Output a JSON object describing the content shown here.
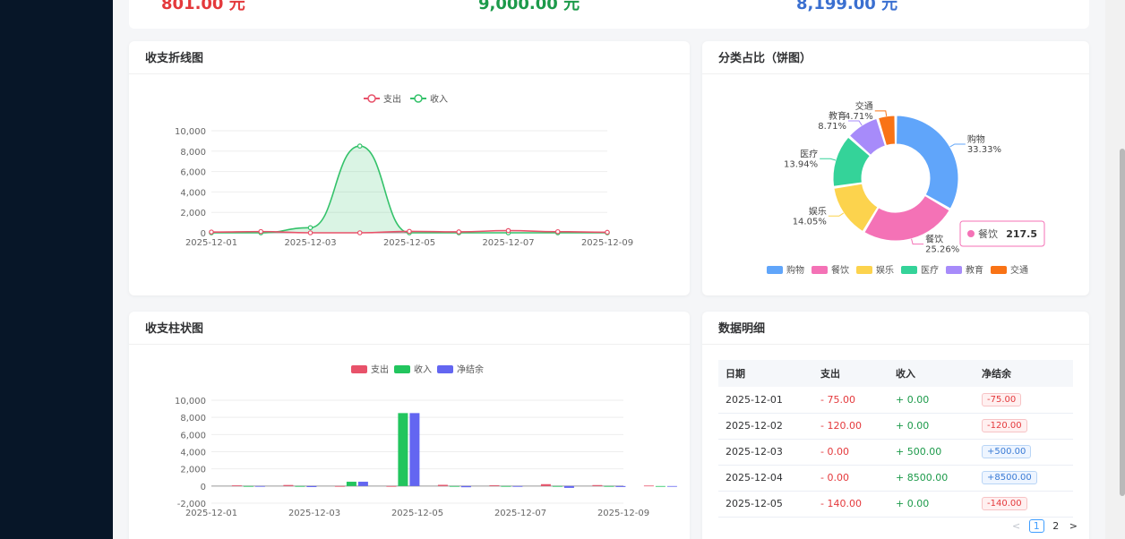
{
  "stats": {
    "expense": "801.00 元",
    "income": "9,000.00 元",
    "balance": "8,199.00 元"
  },
  "colors": {
    "expense": "#e4393c",
    "income": "#1c9a4a",
    "balance": "#3a6fd0",
    "net": "#6366f1"
  },
  "line_card": {
    "title": "收支折线图"
  },
  "pie_card": {
    "title": "分类占比（饼图）"
  },
  "bar_card": {
    "title": "收支柱状图"
  },
  "table_card": {
    "title": "数据明细"
  },
  "pie_tooltip": {
    "label": "餐饮",
    "value": "217.5"
  },
  "chart_data": [
    {
      "type": "line",
      "legend": [
        "支出",
        "收入"
      ],
      "x": [
        "2025-12-01",
        "2025-12-02",
        "2025-12-03",
        "2025-12-04",
        "2025-12-05",
        "2025-12-06",
        "2025-12-07",
        "2025-12-08",
        "2025-12-09"
      ],
      "x_tick_labels": [
        "2025-12-01",
        "2025-12-03",
        "2025-12-05",
        "2025-12-07",
        "2025-12-09"
      ],
      "series": [
        {
          "name": "支出",
          "color": "#e8526a",
          "values": [
            75,
            120,
            0,
            0,
            140,
            90,
            216,
            110,
            50
          ]
        },
        {
          "name": "收入",
          "color": "#34c26a",
          "values": [
            0,
            0,
            500,
            8500,
            0,
            0,
            0,
            0,
            0
          ],
          "area": true
        }
      ],
      "y_ticks": [
        "0",
        "2,000",
        "4,000",
        "6,000",
        "8,000",
        "10,000"
      ],
      "ylim": [
        0,
        10000
      ]
    },
    {
      "type": "pie",
      "slices": [
        {
          "label": "购物",
          "percent": "33.33%",
          "value": 33.33,
          "color": "#60a5fa"
        },
        {
          "label": "餐饮",
          "percent": "25.26%",
          "value": 25.26,
          "color": "#f472b6"
        },
        {
          "label": "娱乐",
          "percent": "14.05%",
          "value": 14.05,
          "color": "#fcd34d"
        },
        {
          "label": "医疗",
          "percent": "13.94%",
          "value": 13.94,
          "color": "#34d399"
        },
        {
          "label": "教育",
          "percent": "8.71%",
          "value": 8.71,
          "color": "#a78bfa"
        },
        {
          "label": "交通",
          "percent": "4.71%",
          "value": 4.71,
          "color": "#f97316"
        }
      ]
    },
    {
      "type": "bar",
      "legend": [
        "支出",
        "收入",
        "净结余"
      ],
      "x": [
        "2025-12-01",
        "2025-12-02",
        "2025-12-03",
        "2025-12-04",
        "2025-12-05",
        "2025-12-06",
        "2025-12-07",
        "2025-12-08",
        "2025-12-09"
      ],
      "x_tick_labels": [
        "2025-12-01",
        "2025-12-03",
        "2025-12-05",
        "2025-12-07",
        "2025-12-09"
      ],
      "series": [
        {
          "name": "支出",
          "color": "#e8526a",
          "values": [
            75,
            120,
            0,
            0,
            140,
            90,
            216,
            110,
            50
          ]
        },
        {
          "name": "收入",
          "color": "#22c55e",
          "values": [
            0,
            0,
            500,
            8500,
            0,
            0,
            0,
            0,
            0
          ]
        },
        {
          "name": "净结余",
          "color": "#6366f1",
          "values": [
            -75,
            -120,
            500,
            8500,
            -140,
            -90,
            -216,
            -110,
            -50
          ]
        }
      ],
      "y_ticks": [
        "-2,000",
        "0",
        "2,000",
        "4,000",
        "6,000",
        "8,000",
        "10,000"
      ],
      "ylim": [
        -2000,
        10000
      ]
    }
  ],
  "table": {
    "headers": [
      "日期",
      "支出",
      "收入",
      "净结余"
    ],
    "rows": [
      {
        "date": "2025-12-01",
        "expense": "- 75.00",
        "income": "+ 0.00",
        "net": "-75.00",
        "neg": true
      },
      {
        "date": "2025-12-02",
        "expense": "- 120.00",
        "income": "+ 0.00",
        "net": "-120.00",
        "neg": true
      },
      {
        "date": "2025-12-03",
        "expense": "- 0.00",
        "income": "+ 500.00",
        "net": "+500.00",
        "neg": false
      },
      {
        "date": "2025-12-04",
        "expense": "- 0.00",
        "income": "+ 8500.00",
        "net": "+8500.00",
        "neg": false
      },
      {
        "date": "2025-12-05",
        "expense": "- 140.00",
        "income": "+ 0.00",
        "net": "-140.00",
        "neg": true
      }
    ]
  },
  "pagination": {
    "prev": "<",
    "pages": [
      "1",
      "2"
    ],
    "next": ">"
  }
}
